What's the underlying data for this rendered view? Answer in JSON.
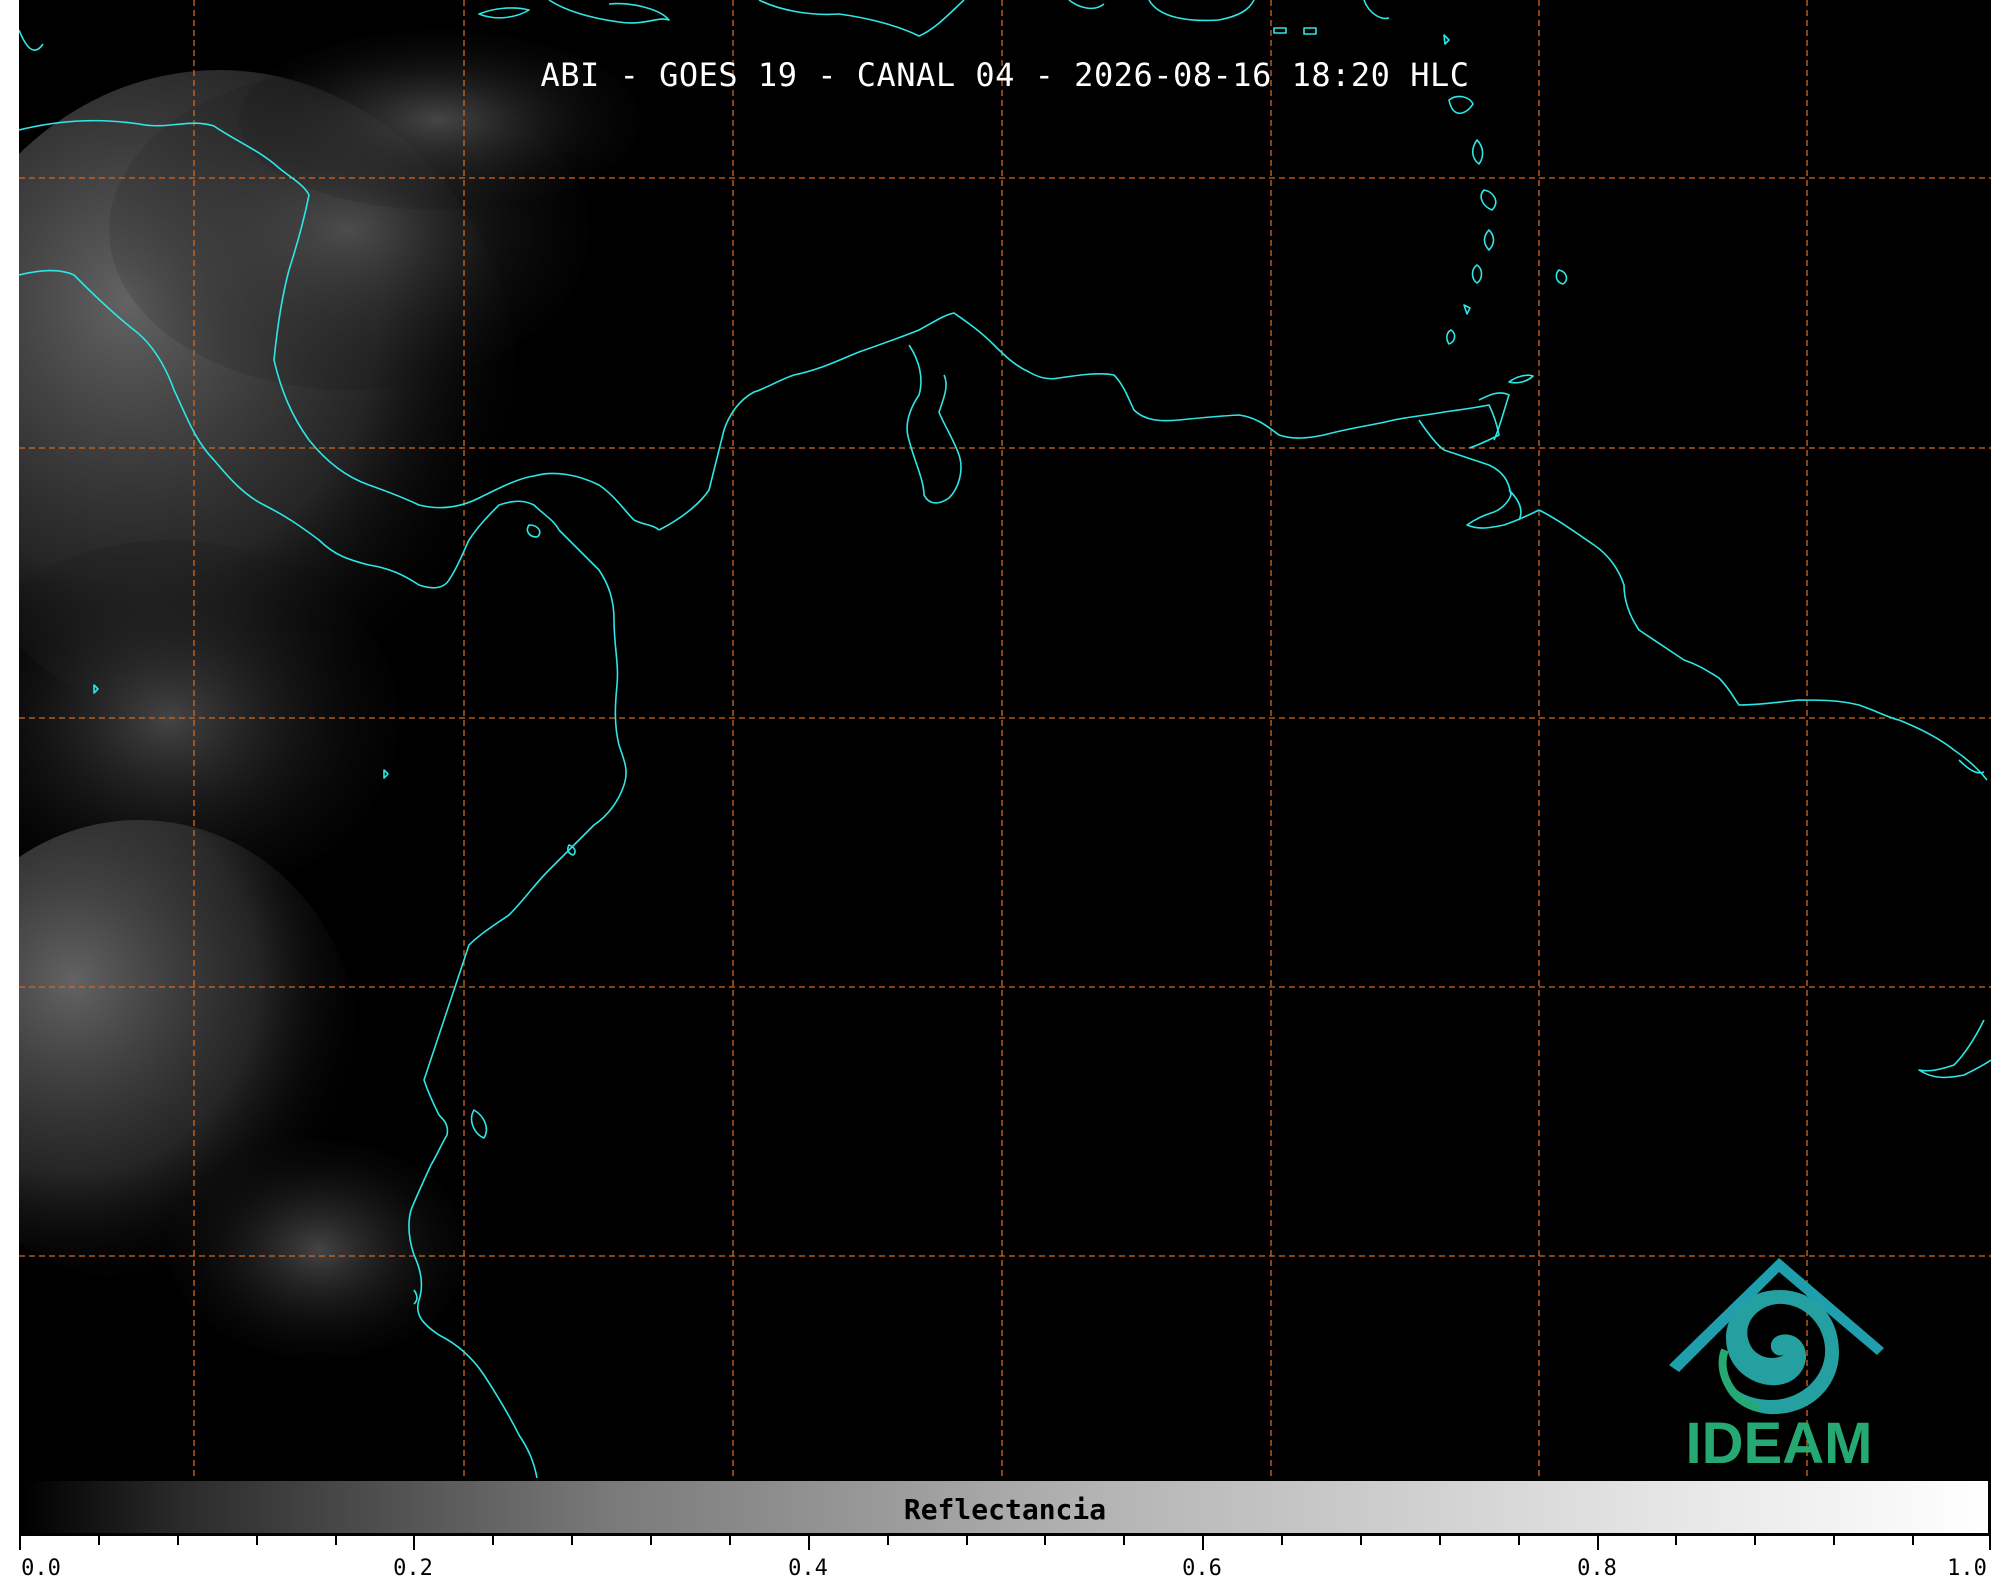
{
  "title": "ABI - GOES 19 - CANAL 04 - 2026-08-16 18:20 HLC",
  "colors": {
    "background": "#000000",
    "coastline": "#2ee6e6",
    "graticule": "#d2691e",
    "logo_teal": "#1f9fae",
    "logo_green": "#25a872"
  },
  "logo": {
    "text": "IDEAM",
    "icon": "ideam-logo-icon"
  },
  "colorbar": {
    "label": "Reflectancia",
    "range": [
      0.0,
      1.0
    ],
    "tick_labels": [
      "0.0",
      "0.2",
      "0.4",
      "0.6",
      "0.8",
      "1.0"
    ],
    "minor_ticks_per_interval": 4
  }
}
